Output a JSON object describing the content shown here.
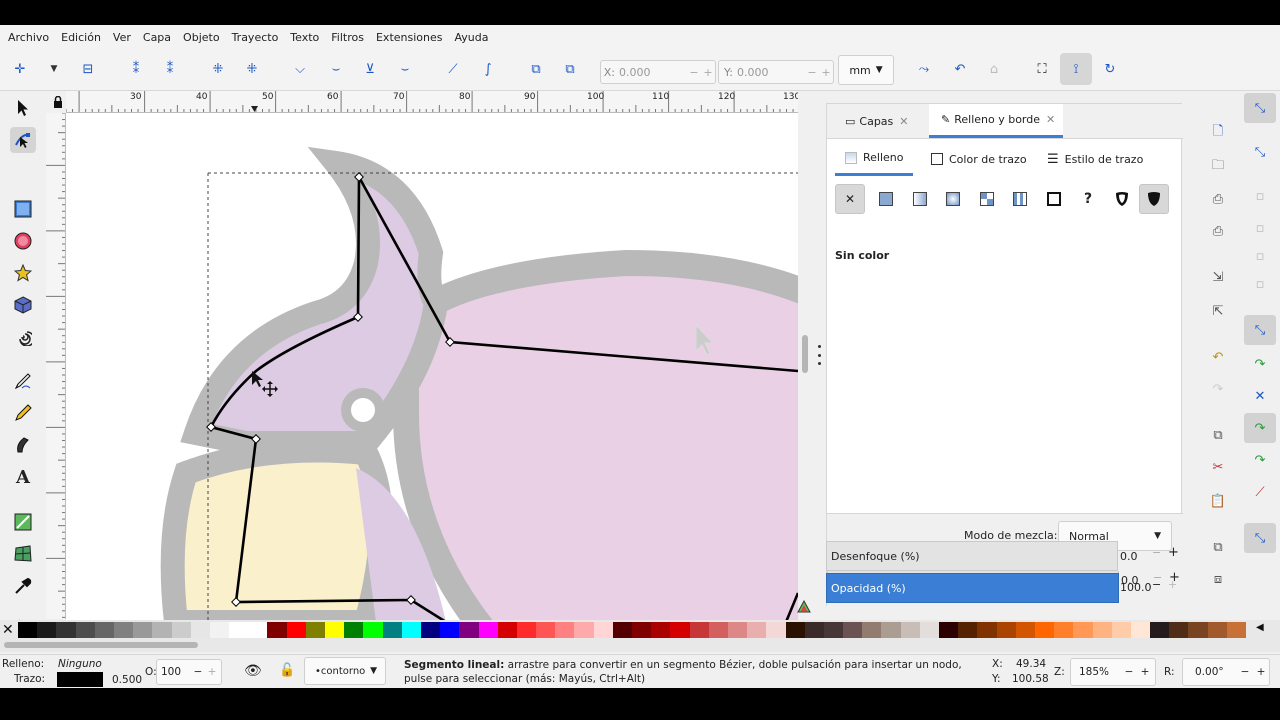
{
  "menu": [
    "Archivo",
    "Edición",
    "Ver",
    "Capa",
    "Objeto",
    "Trayecto",
    "Texto",
    "Filtros",
    "Extensiones",
    "Ayuda"
  ],
  "toolbar": {
    "x_label": "X:",
    "x_value": "0.000",
    "y_label": "Y:",
    "y_value": "0.000",
    "unit": "mm"
  },
  "ruler": {
    "h_labels": [
      "30",
      "40",
      "50",
      "60",
      "70",
      "80",
      "90",
      "100",
      "110",
      "120",
      "130"
    ]
  },
  "dialog": {
    "tab_layers": "Capas",
    "tab_fill_stroke": "Relleno y borde",
    "sub_fill": "Relleno",
    "sub_stroke_paint": "Color de trazo",
    "sub_stroke_style": "Estilo de trazo",
    "unknown_button": "?",
    "fill_status": "Sin color",
    "blend_label": "Modo de mezcla:",
    "blend_value": "Normal",
    "blur_label": "Desenfoque (%)",
    "blur_value": "0.0",
    "opacity_label": "Opacidad (%)",
    "opacity_value": "100.0"
  },
  "status": {
    "fill_label": "Relleno:",
    "fill_value": "Ninguno",
    "stroke_label": "Trazo:",
    "stroke_width": "0.500",
    "o_label": "O:",
    "o_value": "100",
    "layer": "•contorno",
    "message_bold": "Segmento lineal:",
    "message": "arrastre para convertir en un segmento Bézier, doble pulsación para insertar un nodo, pulse para seleccionar (más: Mayús, Ctrl+Alt)",
    "x_label": "X:",
    "x_value": "49.34",
    "y_label": "Y:",
    "y_value": "100.58",
    "zoom_label": "Z:",
    "zoom_value": "185%",
    "rot_label": "R:",
    "rot_value": "0.00°"
  },
  "palette_colors": [
    "#000000",
    "#1a1a1a",
    "#333333",
    "#4d4d4d",
    "#666666",
    "#808080",
    "#999999",
    "#b3b3b3",
    "#cccccc",
    "#e6e6e6",
    "#f2f2f2",
    "#ffffff",
    "#ffffff",
    "#800000",
    "#ff0000",
    "#808000",
    "#ffff00",
    "#008000",
    "#00ff00",
    "#008080",
    "#00ffff",
    "#000080",
    "#0000ff",
    "#800080",
    "#ff00ff",
    "#d40000",
    "#ff2a2a",
    "#ff5555",
    "#ff8080",
    "#ffaaaa",
    "#ffd5d5",
    "#550000",
    "#800000",
    "#aa0000",
    "#d40000",
    "#c83737",
    "#d35f5f",
    "#de8787",
    "#e9afaf",
    "#f4d7d7",
    "#2b1100",
    "#3a2a2a",
    "#483737",
    "#6c5353",
    "#917c6f",
    "#ac9d93",
    "#c8beb7",
    "#e3dedb",
    "#2b0000",
    "#552200",
    "#803300",
    "#aa4400",
    "#d45500",
    "#ff6600",
    "#ff7f2a",
    "#ff9955",
    "#ffb380",
    "#ffccaa",
    "#ffe6d5",
    "#241c1c",
    "#502d16",
    "#784421",
    "#a05a2c",
    "#c87137"
  ]
}
